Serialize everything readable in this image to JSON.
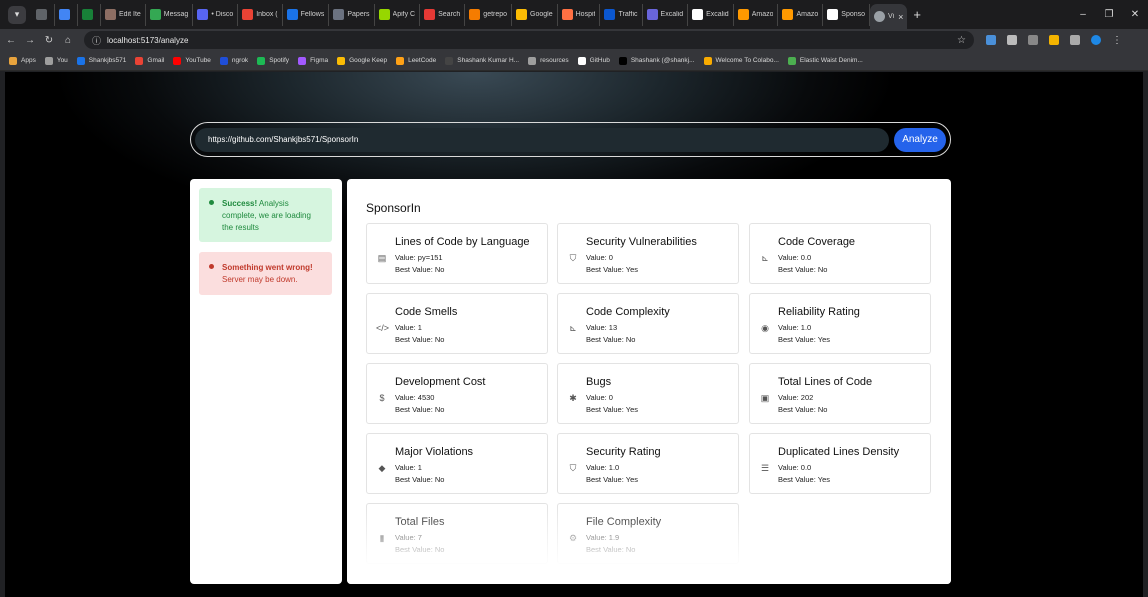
{
  "browser": {
    "tabs": [
      {
        "label": "",
        "color": "#5f6368"
      },
      {
        "label": "",
        "color": "#4285f4"
      },
      {
        "label": "",
        "color": "#188038"
      },
      {
        "label": "Edit Ite",
        "color": "#8d6e63"
      },
      {
        "label": "Messag",
        "color": "#34a853"
      },
      {
        "label": "• Disco",
        "color": "#5865f2"
      },
      {
        "label": "Inbox (",
        "color": "#ea4335"
      },
      {
        "label": "Fellows",
        "color": "#1a73e8"
      },
      {
        "label": "Papers",
        "color": "#6b7280"
      },
      {
        "label": "Apify C",
        "color": "#97d700"
      },
      {
        "label": "Search",
        "color": "#e53935"
      },
      {
        "label": "getrepo",
        "color": "#f57c00"
      },
      {
        "label": "Google",
        "color": "#fbbc04"
      },
      {
        "label": "Hospit",
        "color": "#ff7043"
      },
      {
        "label": "Traffic",
        "color": "#0b57d0"
      },
      {
        "label": "Excalid",
        "color": "#6965db"
      },
      {
        "label": "Excalid",
        "color": "#ffffff"
      },
      {
        "label": "Amazo",
        "color": "#ff9900"
      },
      {
        "label": "Amazo",
        "color": "#ff9900"
      },
      {
        "label": "Sponso",
        "color": "#ffffff"
      }
    ],
    "active_tab": {
      "label": "Vi",
      "close": "×"
    },
    "new_tab": "+",
    "window_controls": {
      "minimize": "–",
      "restore": "❐",
      "close": "✕"
    },
    "url": "localhost:5173/analyze",
    "bookmarks": [
      {
        "label": "Apps",
        "color": "#e8a33d"
      },
      {
        "label": "You",
        "color": "#9e9e9e"
      },
      {
        "label": "Shankjbs571",
        "color": "#1a73e8"
      },
      {
        "label": "Gmail",
        "color": "#ea4335"
      },
      {
        "label": "YouTube",
        "color": "#ff0000"
      },
      {
        "label": "ngrok",
        "color": "#1f4ed8"
      },
      {
        "label": "Spotify",
        "color": "#1db954"
      },
      {
        "label": "Figma",
        "color": "#a259ff"
      },
      {
        "label": "Google Keep",
        "color": "#fbbc04"
      },
      {
        "label": "LeetCode",
        "color": "#ffa116"
      },
      {
        "label": "Shashank Kumar H...",
        "color": "#444444"
      },
      {
        "label": "resources",
        "color": "#9e9e9e"
      },
      {
        "label": "GitHub",
        "color": "#ffffff"
      },
      {
        "label": "Shashank (@shankj...",
        "color": "#000000"
      },
      {
        "label": "Welcome To Colabo...",
        "color": "#f9ab00"
      },
      {
        "label": "Elastic Waist Denim...",
        "color": "#4caf50"
      }
    ]
  },
  "search": {
    "value": "https://github.com/Shankjbs571/SponsorIn",
    "button_label": "Analyze"
  },
  "notifications": {
    "success": {
      "title": "Success!",
      "message": " Analysis complete, we are loading the results"
    },
    "error": {
      "title": "Something went wrong!",
      "message": " Server may be down."
    }
  },
  "repo_name": "SponsorIn",
  "metrics": [
    {
      "title": "Lines of Code by Language",
      "value": "Value: py=151",
      "best": "Best Value: No",
      "icon": "id-card-icon",
      "glyph": "▤"
    },
    {
      "title": "Security Vulnerabilities",
      "value": "Value: 0",
      "best": "Best Value: Yes",
      "icon": "shield-icon",
      "glyph": "⛉"
    },
    {
      "title": "Code Coverage",
      "value": "Value: 0.0",
      "best": "Best Value: No",
      "icon": "chart-icon",
      "glyph": "⊾"
    },
    {
      "title": "Code Smells",
      "value": "Value: 1",
      "best": "Best Value: No",
      "icon": "code-icon",
      "glyph": "</>"
    },
    {
      "title": "Code Complexity",
      "value": "Value: 13",
      "best": "Best Value: No",
      "icon": "chart-icon",
      "glyph": "⊾"
    },
    {
      "title": "Reliability Rating",
      "value": "Value: 1.0",
      "best": "Best Value: Yes",
      "icon": "gauge-icon",
      "glyph": "◉"
    },
    {
      "title": "Development Cost",
      "value": "Value: 4530",
      "best": "Best Value: No",
      "icon": "dollar-icon",
      "glyph": "$"
    },
    {
      "title": "Bugs",
      "value": "Value: 0",
      "best": "Best Value: Yes",
      "icon": "bug-icon",
      "glyph": "✱"
    },
    {
      "title": "Total Lines of Code",
      "value": "Value: 202",
      "best": "Best Value: No",
      "icon": "file-icon",
      "glyph": "▣"
    },
    {
      "title": "Major Violations",
      "value": "Value: 1",
      "best": "Best Value: No",
      "icon": "tag-icon",
      "glyph": "◆"
    },
    {
      "title": "Security Rating",
      "value": "Value: 1.0",
      "best": "Best Value: Yes",
      "icon": "shield-icon",
      "glyph": "⛉"
    },
    {
      "title": "Duplicated Lines Density",
      "value": "Value: 0.0",
      "best": "Best Value: Yes",
      "icon": "list-icon",
      "glyph": "☰"
    },
    {
      "title": "Total Files",
      "value": "Value: 7",
      "best": "Best Value: No",
      "icon": "file-icon",
      "glyph": "▮"
    },
    {
      "title": "File Complexity",
      "value": "Value: 1.9",
      "best": "Best Value: No",
      "icon": "gear-icon",
      "glyph": "⚙"
    }
  ]
}
